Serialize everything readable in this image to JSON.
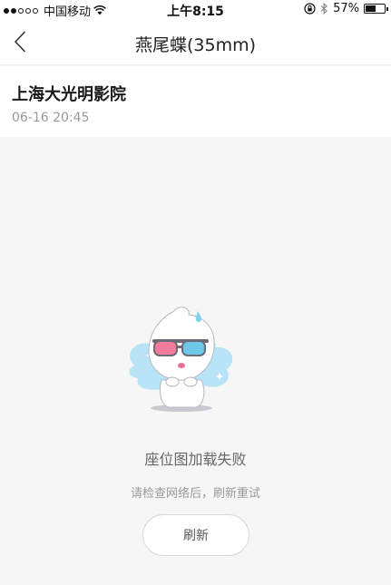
{
  "status_bar": {
    "carrier": "中国移动",
    "time": "上午8:15",
    "battery": "57%",
    "battery_level": 0.57
  },
  "nav": {
    "title": "燕尾蝶(35mm)"
  },
  "cinema": {
    "name": "上海大光明影院",
    "show_time": "06-16 20:45"
  },
  "error": {
    "title": "座位图加载失败",
    "hint": "请检查网络后，刷新重试",
    "refresh_label": "刷新"
  },
  "icons": {
    "back": "chevron-left-icon",
    "wifi": "wifi-icon",
    "lock": "orientation-lock-icon",
    "bluetooth": "bluetooth-icon",
    "battery": "battery-icon",
    "mascot": "mascot-3d-glasses-illustration"
  },
  "colors": {
    "page_background": "#f6f6f6",
    "mascot_cloud": "#b9e3f6",
    "glasses_left_lens": "#f27b9c",
    "glasses_right_lens": "#6cc8e8"
  }
}
